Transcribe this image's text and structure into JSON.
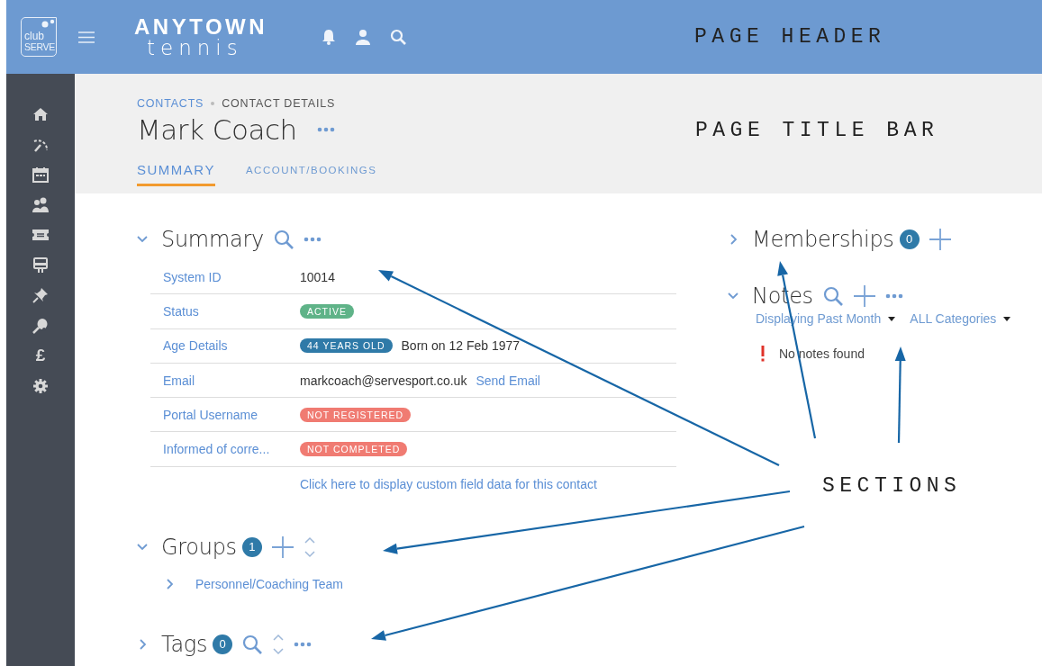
{
  "header": {
    "logo": {
      "top": "club",
      "bottom": "SERVE"
    },
    "brand": {
      "name": "ANYTOWN",
      "sport": "tennis"
    },
    "annotation": "PAGE HEADER"
  },
  "sidebar": {
    "currency": "£"
  },
  "title_bar": {
    "breadcrumb": [
      "CONTACTS",
      "CONTACT DETAILS"
    ],
    "title": "Mark Coach",
    "annotation": "PAGE TITLE BAR",
    "tabs": [
      {
        "label": "SUMMARY",
        "selected": true
      },
      {
        "label": "ACCOUNT/BOOKINGS",
        "selected": false
      }
    ]
  },
  "summary": {
    "title": "Summary",
    "expanded": true,
    "actions": [
      {
        "kind": "search"
      },
      {
        "kind": "more"
      }
    ],
    "rows": [
      {
        "label": "System ID",
        "value": "10014"
      },
      {
        "label": "Status",
        "badge": {
          "text": "ACTIVE",
          "color": "#5fb388"
        }
      },
      {
        "label": "Age Details",
        "badge": {
          "text": "44 YEARS OLD",
          "color": "#2f7aa8"
        },
        "value": "Born on 12 Feb 1977"
      },
      {
        "label": "Email",
        "value": "markcoach@servesport.co.uk",
        "link": "Send Email"
      },
      {
        "label": "Portal Username",
        "badge": {
          "text": "NOT REGISTERED",
          "color": "#f07b72"
        }
      },
      {
        "label": "Informed of corre...",
        "badge": {
          "text": "NOT COMPLETED",
          "color": "#f07b72"
        }
      }
    ],
    "footer_link": "Click here to display custom field data for this contact"
  },
  "groups": {
    "title": "Groups",
    "expanded": true,
    "count": "1",
    "actions": [
      {
        "kind": "add"
      },
      {
        "kind": "sort"
      }
    ],
    "items": [
      "Personnel/Coaching Team"
    ]
  },
  "tags": {
    "title": "Tags",
    "expanded": false,
    "count": "0",
    "actions": [
      {
        "kind": "search"
      },
      {
        "kind": "sort"
      },
      {
        "kind": "more"
      }
    ]
  },
  "memberships": {
    "title": "Memberships",
    "expanded": false,
    "count": "0",
    "actions": [
      {
        "kind": "add"
      }
    ]
  },
  "notes": {
    "title": "Notes",
    "expanded": true,
    "actions": [
      {
        "kind": "search"
      },
      {
        "kind": "add"
      },
      {
        "kind": "more"
      }
    ],
    "filters": [
      "Displaying Past Month",
      "ALL Categories"
    ],
    "empty_message": "No notes found"
  },
  "sections_annotation": "SECTIONS"
}
